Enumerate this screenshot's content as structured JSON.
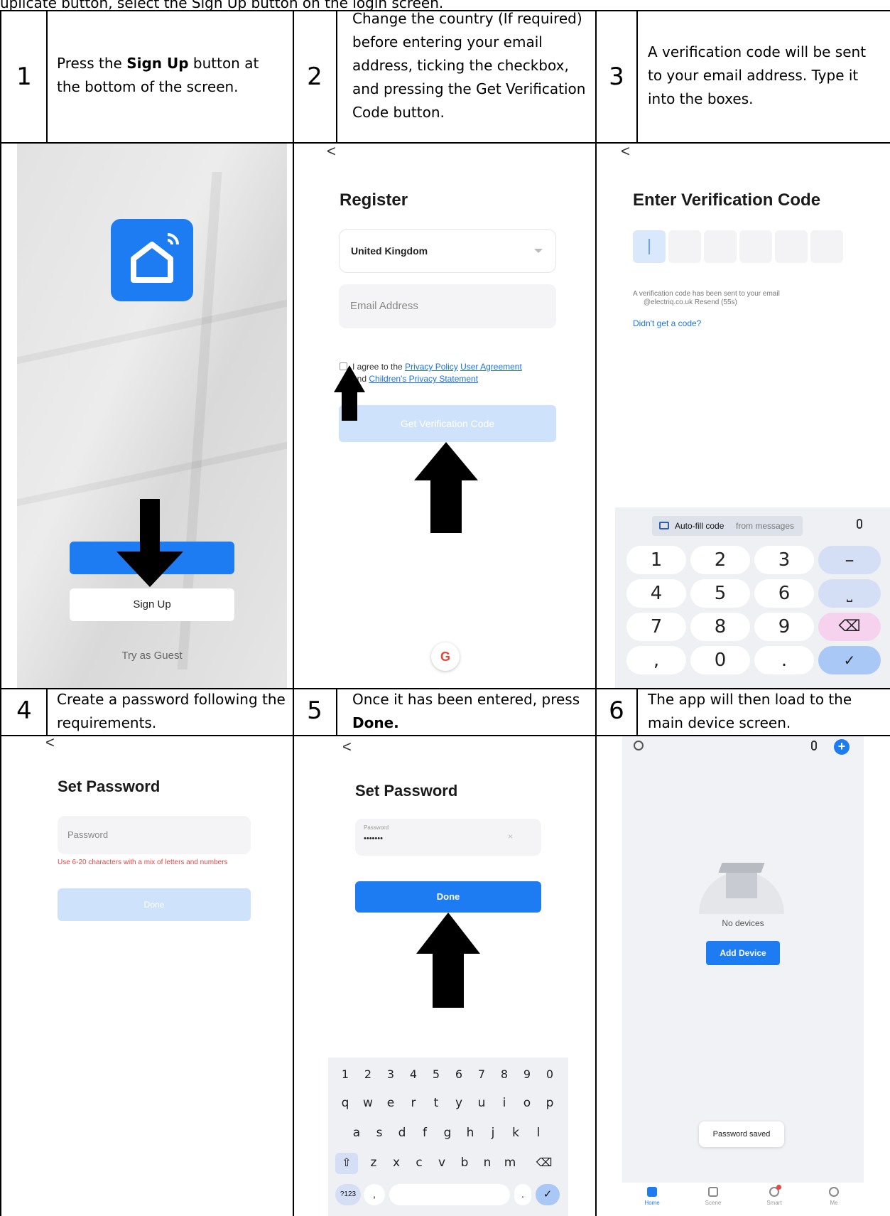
{
  "intro": "uplicate button, select the Sign Up button on the login screen.",
  "steps": [
    {
      "num": "1",
      "text_before": "Press the ",
      "bold": "Sign Up",
      "text_after": " button at the bottom of the screen."
    },
    {
      "num": "2",
      "text": "Change the country (If required) before entering your email address, ticking the checkbox, and pressing the Get Verification Code button."
    },
    {
      "num": "3",
      "text": "A verification code will be sent to your email address. Type it into the boxes."
    },
    {
      "num": "4",
      "text": "Create a password following the requirements."
    },
    {
      "num": "5",
      "text_before": "Once it has been entered, press ",
      "bold": "Done."
    },
    {
      "num": "6",
      "text": "The app will then load to the main device screen."
    }
  ],
  "screen1": {
    "signup": "Sign Up",
    "guest": "Try as Guest"
  },
  "screen2": {
    "back": "<",
    "title": "Register",
    "country": "United Kingdom",
    "email_placeholder": "Email Address",
    "agree_prefix": "I agree to the ",
    "privacy_policy": "Privacy Policy",
    "user_agreement": "User Agreement",
    "and": "and ",
    "childrens": "Children's Privacy Statement",
    "get_code": "Get Verification Code",
    "google": "G"
  },
  "screen3": {
    "back": "<",
    "title": "Enter Verification Code",
    "sent_line1": "A verification code has been sent to your email",
    "sent_line2": "@electriq.co.uk Resend (55s)",
    "didnt_get": "Didn't get a code?",
    "autofill": "Auto-fill code",
    "from_messages": "from messages",
    "keys": [
      "1",
      "2",
      "3",
      "–",
      "4",
      "5",
      "6",
      "⎵",
      "7",
      "8",
      "9",
      "⌫",
      ",",
      "0",
      ".",
      "✓"
    ]
  },
  "screen4": {
    "back": "<",
    "title": "Set Password",
    "placeholder": "Password",
    "hint": "Use 6-20 characters with a mix of letters and numbers",
    "done": "Done"
  },
  "screen5": {
    "back": "<",
    "title": "Set Password",
    "field_label": "Password",
    "field_value": "•••••••",
    "done": "Done",
    "keyboard_rows": [
      [
        "1",
        "2",
        "3",
        "4",
        "5",
        "6",
        "7",
        "8",
        "9",
        "0"
      ],
      [
        "q",
        "w",
        "e",
        "r",
        "t",
        "y",
        "u",
        "i",
        "o",
        "p"
      ],
      [
        "a",
        "s",
        "d",
        "f",
        "g",
        "h",
        "j",
        "k",
        "l"
      ],
      [
        "z",
        "x",
        "c",
        "v",
        "b",
        "n",
        "m"
      ]
    ],
    "key_123": "?123",
    "key_comma": ",",
    "key_dot": "."
  },
  "screen6": {
    "no_devices": "No devices",
    "add_device": "Add Device",
    "toast": "Password saved",
    "tabs": [
      "Home",
      "Scene",
      "Smart",
      "Me"
    ]
  },
  "colors": {
    "accent": "#1e7cf2",
    "light_accent": "#cfe2fb",
    "hint_red": "#e04646",
    "link": "#1a73e8"
  }
}
